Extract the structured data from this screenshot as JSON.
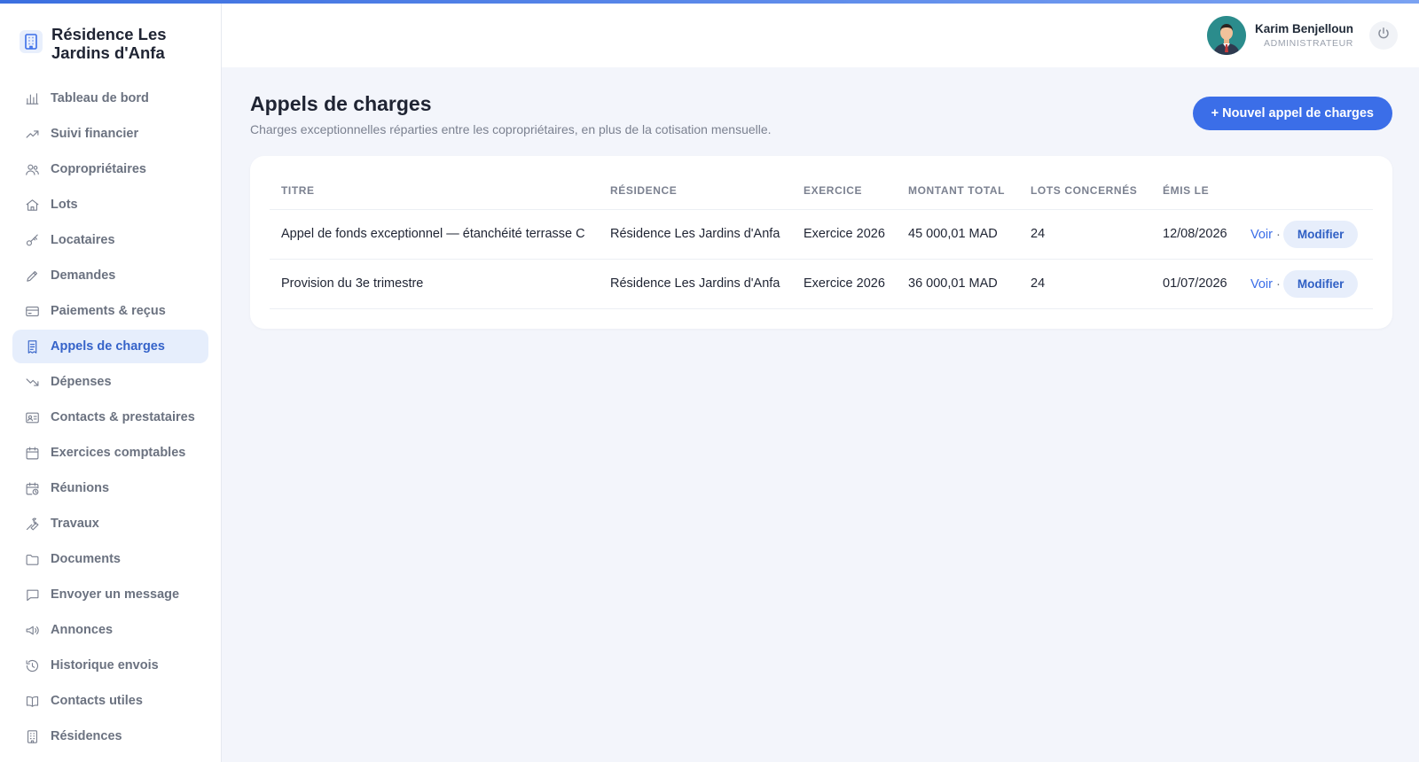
{
  "brand": {
    "name": "Résidence Les Jardins d'Anfa"
  },
  "sidebar": {
    "items": [
      {
        "label": "Tableau de bord",
        "icon": "bar-chart-icon"
      },
      {
        "label": "Suivi financier",
        "icon": "trending-up-icon"
      },
      {
        "label": "Copropriétaires",
        "icon": "users-icon"
      },
      {
        "label": "Lots",
        "icon": "home-icon"
      },
      {
        "label": "Locataires",
        "icon": "key-icon"
      },
      {
        "label": "Demandes",
        "icon": "pencil-icon"
      },
      {
        "label": "Paiements & reçus",
        "icon": "credit-card-icon"
      },
      {
        "label": "Appels de charges",
        "icon": "receipt-icon",
        "active": true
      },
      {
        "label": "Dépenses",
        "icon": "trending-down-icon"
      },
      {
        "label": "Contacts & prestataires",
        "icon": "id-card-icon"
      },
      {
        "label": "Exercices comptables",
        "icon": "calendar-icon"
      },
      {
        "label": "Réunions",
        "icon": "calendar-clock-icon"
      },
      {
        "label": "Travaux",
        "icon": "wrench-icon"
      },
      {
        "label": "Documents",
        "icon": "folder-icon"
      },
      {
        "label": "Envoyer un message",
        "icon": "message-icon"
      },
      {
        "label": "Annonces",
        "icon": "megaphone-icon"
      },
      {
        "label": "Historique envois",
        "icon": "history-icon"
      },
      {
        "label": "Contacts utiles",
        "icon": "book-icon"
      },
      {
        "label": "Résidences",
        "icon": "building-icon"
      }
    ]
  },
  "user": {
    "name": "Karim Benjelloun",
    "role": "ADMINISTRATEUR"
  },
  "page": {
    "title": "Appels de charges",
    "subtitle": "Charges exceptionnelles réparties entre les copropriétaires, en plus de la cotisation mensuelle.",
    "new_button": "+ Nouvel appel de charges"
  },
  "table": {
    "headers": [
      "TITRE",
      "RÉSIDENCE",
      "EXERCICE",
      "MONTANT TOTAL",
      "LOTS CONCERNÉS",
      "ÉMIS LE"
    ],
    "rows": [
      {
        "titre": "Appel de fonds exceptionnel — étanchéité terrasse C",
        "residence": "Résidence Les Jardins d'Anfa",
        "exercice": "Exercice 2026",
        "montant": "45 000,01 MAD",
        "lots": "24",
        "emis": "12/08/2026",
        "voir": "Voir",
        "sep": "·",
        "modifier": "Modifier"
      },
      {
        "titre": "Provision du 3e trimestre",
        "residence": "Résidence Les Jardins d'Anfa",
        "exercice": "Exercice 2026",
        "montant": "36 000,01 MAD",
        "lots": "24",
        "emis": "01/07/2026",
        "voir": "Voir",
        "sep": "·",
        "modifier": "Modifier"
      }
    ]
  },
  "colors": {
    "accent": "#3b6ee8",
    "active_bg": "#e6eefc",
    "active_text": "#3563c9"
  }
}
